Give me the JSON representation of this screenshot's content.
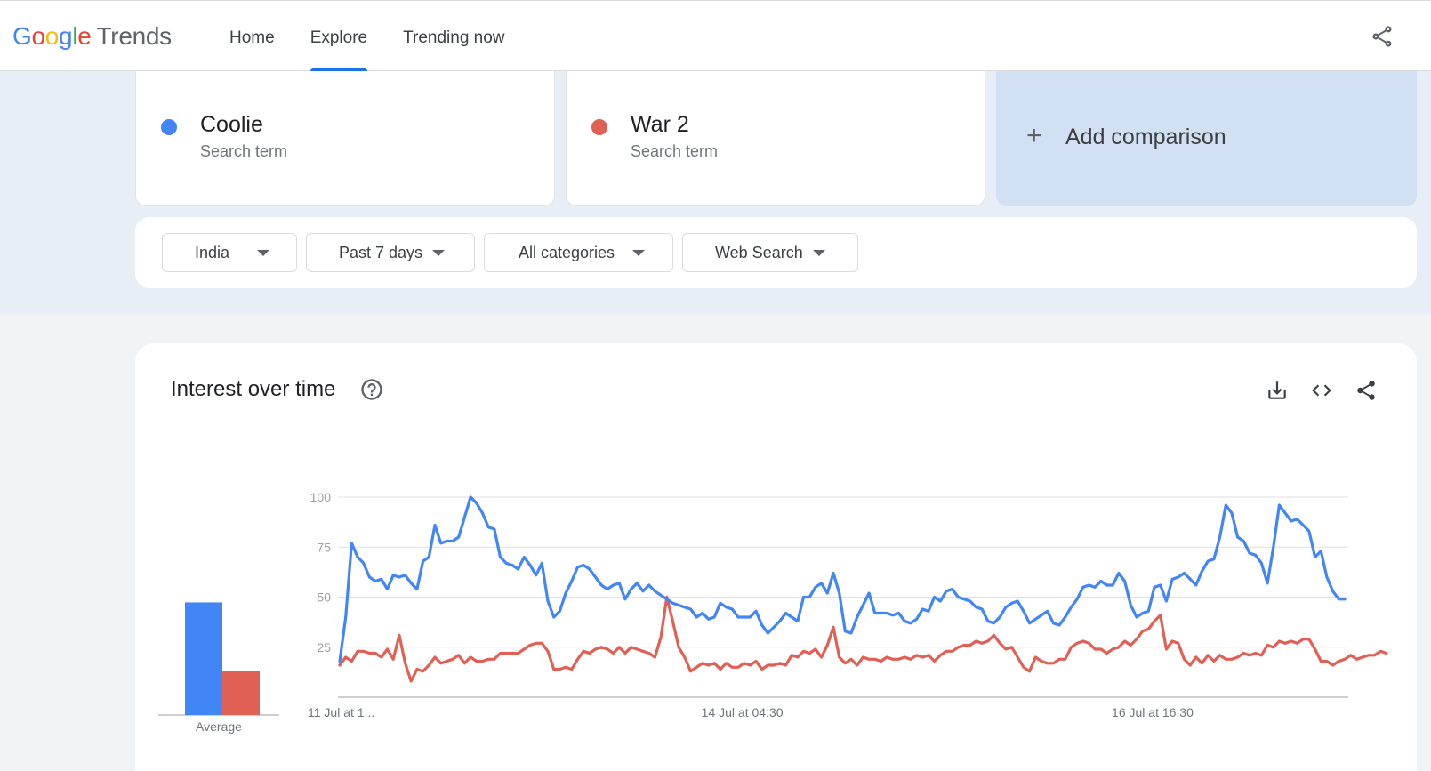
{
  "header": {
    "logo": {
      "g1": "G",
      "g2": "o",
      "g3": "o",
      "g4": "g",
      "g5": "l",
      "g6": "e",
      "product": "Trends"
    },
    "nav": [
      {
        "label": "Home",
        "active": false
      },
      {
        "label": "Explore",
        "active": true
      },
      {
        "label": "Trending now",
        "active": false
      }
    ],
    "share_icon": "share-icon"
  },
  "terms": [
    {
      "name": "Coolie",
      "type": "Search term",
      "color": "#4285f4"
    },
    {
      "name": "War 2",
      "type": "Search term",
      "color": "#db4437"
    }
  ],
  "add_comparison": {
    "icon": "plus-icon",
    "label": "Add comparison"
  },
  "filters": {
    "region": "India",
    "time": "Past 7 days",
    "category": "All categories",
    "property": "Web Search"
  },
  "interest_card": {
    "title": "Interest over time",
    "icons": [
      "help-icon",
      "download-icon",
      "embed-icon",
      "share-icon"
    ]
  },
  "colors": {
    "accent": "#1a73e8",
    "coolie": "#4285f4",
    "war2": "#db4437"
  },
  "chart_data": [
    {
      "type": "bar",
      "categories": [
        "Average"
      ],
      "series": [
        {
          "name": "Coolie",
          "values": [
            56
          ]
        },
        {
          "name": "War 2",
          "values": [
            22
          ]
        }
      ],
      "ylim": [
        0,
        100
      ]
    },
    {
      "type": "line",
      "ylim": [
        0,
        100
      ],
      "yticks": [
        25,
        50,
        75,
        100
      ],
      "grid": true,
      "x_tick_labels": [
        "11 Jul at 1...",
        "14 Jul at 04:30",
        "16 Jul at 16:30"
      ],
      "x_tick_index": [
        0,
        68,
        137
      ],
      "series": [
        {
          "name": "Coolie",
          "values": [
            18,
            40,
            77,
            70,
            67,
            60,
            58,
            59,
            54,
            61,
            60,
            61,
            57,
            54,
            68,
            70,
            86,
            77,
            78,
            78,
            80,
            90,
            100,
            97,
            92,
            85,
            84,
            70,
            67,
            66,
            64,
            70,
            66,
            61,
            67,
            48,
            40,
            43,
            52,
            58,
            65,
            66,
            64,
            60,
            56,
            54,
            56,
            57,
            49,
            54,
            57,
            53,
            56,
            53,
            51,
            49,
            47,
            46,
            45,
            44,
            40,
            42,
            39,
            40,
            47,
            45,
            44,
            40,
            40,
            40,
            43,
            36,
            32,
            35,
            38,
            42,
            40,
            38,
            50,
            50,
            55,
            57,
            52,
            62,
            52,
            33,
            32,
            40,
            46,
            52,
            42,
            42,
            42,
            41,
            42,
            38,
            37,
            39,
            44,
            43,
            50,
            48,
            53,
            54,
            50,
            49,
            48,
            45,
            44,
            38,
            37,
            40,
            45,
            47,
            48,
            43,
            37,
            39,
            41,
            43,
            37,
            36,
            40,
            45,
            49,
            55,
            56,
            55,
            58,
            56,
            56,
            62,
            58,
            46,
            40,
            42,
            43,
            55,
            56,
            48,
            59,
            60,
            62,
            59,
            56,
            63,
            68,
            69,
            80,
            96,
            92,
            80,
            78,
            72,
            71,
            67,
            57,
            75,
            96,
            92,
            88,
            89,
            86,
            83,
            70,
            73,
            60,
            53,
            49,
            49
          ]
        },
        {
          "name": "War 2",
          "values": [
            16,
            20,
            18,
            23,
            23,
            22,
            22,
            20,
            24,
            19,
            31,
            17,
            8,
            14,
            13,
            16,
            20,
            17,
            18,
            19,
            21,
            17,
            20,
            18,
            18,
            19,
            19,
            22,
            22,
            22,
            22,
            24,
            26,
            27,
            27,
            23,
            14,
            14,
            15,
            14,
            19,
            23,
            22,
            24,
            25,
            24,
            22,
            25,
            22,
            25,
            24,
            23,
            22,
            20,
            30,
            50,
            38,
            25,
            20,
            13,
            15,
            17,
            16,
            17,
            14,
            17,
            15,
            15,
            17,
            16,
            18,
            14,
            16,
            16,
            17,
            16,
            21,
            20,
            23,
            22,
            24,
            20,
            26,
            35,
            20,
            17,
            19,
            16,
            20,
            19,
            19,
            18,
            20,
            19,
            19,
            20,
            19,
            21,
            20,
            21,
            18,
            21,
            23,
            23,
            25,
            26,
            26,
            28,
            27,
            28,
            31,
            27,
            24,
            25,
            20,
            15,
            13,
            20,
            18,
            17,
            17,
            19,
            19,
            25,
            27,
            28,
            27,
            24,
            24,
            22,
            24,
            25,
            28,
            26,
            29,
            33,
            34,
            38,
            41,
            24,
            28,
            27,
            19,
            16,
            20,
            17,
            21,
            18,
            21,
            19,
            19,
            20,
            22,
            21,
            22,
            21,
            26,
            25,
            28,
            27,
            28,
            27,
            29,
            29,
            24,
            18,
            18,
            16,
            18,
            19,
            21,
            19,
            20,
            21,
            21,
            23,
            22
          ]
        }
      ]
    }
  ]
}
